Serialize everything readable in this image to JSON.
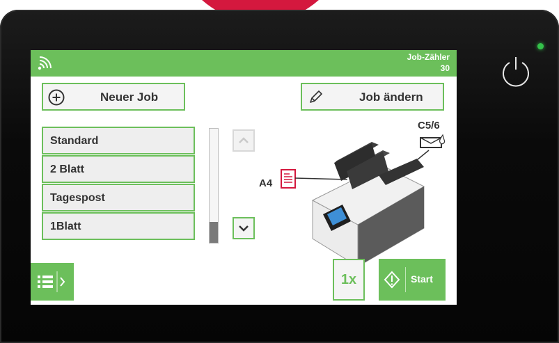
{
  "header": {
    "counter_label": "Job-Zähler",
    "counter_value": "30"
  },
  "actions": {
    "new_job_label": "Neuer Job",
    "edit_job_label": "Job ändern"
  },
  "job_list": [
    {
      "label": "Standard"
    },
    {
      "label": "2 Blatt"
    },
    {
      "label": "Tagespost"
    },
    {
      "label": "1Blatt"
    }
  ],
  "machine": {
    "input_size": "A4",
    "envelope_size": "C5/6"
  },
  "footer": {
    "count_label": "1x",
    "start_label": "Start"
  },
  "colors": {
    "accent": "#6cbf5b",
    "brand_red": "#d4183e",
    "document_red": "#d4183e",
    "device": "#0a0a0a"
  },
  "icons": {
    "wifi": "wifi-icon",
    "add": "plus-circle-icon",
    "edit": "pencil-icon",
    "up": "chevron-up-icon",
    "down": "chevron-down-icon",
    "menu": "list-menu-icon",
    "start": "start-diamond-icon",
    "power": "power-icon"
  }
}
